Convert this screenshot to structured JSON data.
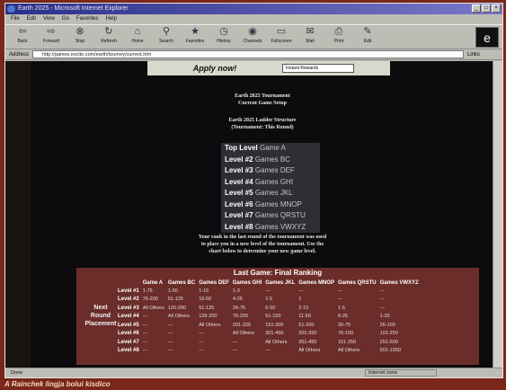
{
  "window": {
    "title": "Earth 2025 - Microsoft Internet Explorer"
  },
  "menu": [
    "File",
    "Edit",
    "View",
    "Go",
    "Favorites",
    "Help"
  ],
  "toolbar": [
    {
      "label": "Back",
      "icon": "back-arrow-icon"
    },
    {
      "label": "Forward",
      "icon": "forward-arrow-icon"
    },
    {
      "label": "Stop",
      "icon": "stop-icon"
    },
    {
      "label": "Refresh",
      "icon": "refresh-icon"
    },
    {
      "label": "Home",
      "icon": "home-icon"
    },
    {
      "label": "Search",
      "icon": "search-icon"
    },
    {
      "label": "Favorites",
      "icon": "favorites-icon"
    },
    {
      "label": "History",
      "icon": "history-icon"
    },
    {
      "label": "Channels",
      "icon": "channels-icon"
    },
    {
      "label": "Fullscreen",
      "icon": "fullscreen-icon"
    },
    {
      "label": "Mail",
      "icon": "mail-icon"
    },
    {
      "label": "Print",
      "icon": "print-icon"
    },
    {
      "label": "Edit",
      "icon": "edit-icon"
    }
  ],
  "address": {
    "label": "Address",
    "url": "http://games.excite.com/earth/tourney/current.htm",
    "links": "Links"
  },
  "banner": {
    "apply": "Apply now!",
    "select": "Instant Rewards"
  },
  "page": {
    "title1": "Earth 2025 Tournament",
    "title2": "Current Game Setup",
    "title3": "Earth 2025 Ladder Structure",
    "title4": "(Tournament: This Round)",
    "levels": [
      {
        "level": "Top Level",
        "games": "Game A"
      },
      {
        "level": "Level #2",
        "games": "Games BC"
      },
      {
        "level": "Level #3",
        "games": "Games DEF"
      },
      {
        "level": "Level #4",
        "games": "Games GHI"
      },
      {
        "level": "Level #5",
        "games": "Games JKL"
      },
      {
        "level": "Level #6",
        "games": "Games MNOP"
      },
      {
        "level": "Level #7",
        "games": "Games QRSTU"
      },
      {
        "level": "Level #8",
        "games": "Games VWXYZ"
      }
    ],
    "desc": [
      "Your rank in the last round of the tournament was used",
      "to place you in a new level of the tournament. Use the",
      "chart below to determine your new game level."
    ],
    "ranking": {
      "title": "Last Game: Final Ranking",
      "side_label": [
        "Next",
        "Round",
        "Placement"
      ],
      "columns": [
        "Game A",
        "Games BC",
        "Games DEF",
        "Games GHI",
        "Games JKL",
        "Games MNOP",
        "Games QRSTU",
        "Games VWXYZ"
      ],
      "rows": [
        {
          "label": "Level #1",
          "cells": [
            "1-75",
            "1-50",
            "1-15",
            "1-3",
            "---",
            "---",
            "---",
            "---"
          ]
        },
        {
          "label": "Level #2",
          "cells": [
            "76-200",
            "51-125",
            "16-50",
            "4-25",
            "1-5",
            "1",
            "---",
            "---"
          ]
        },
        {
          "label": "Level #3",
          "cells": [
            "All Others",
            "126-200",
            "51-125",
            "26-75",
            "6-50",
            "2-10",
            "1-5",
            "---"
          ]
        },
        {
          "label": "Level #4",
          "cells": [
            "---",
            "All Others",
            "126-200",
            "76-200",
            "51-150",
            "11-50",
            "6-25",
            "1-25"
          ]
        },
        {
          "label": "Level #5",
          "cells": [
            "---",
            "---",
            "All Others",
            "201-325",
            "151-300",
            "51-200",
            "26-75",
            "26-100"
          ]
        },
        {
          "label": "Level #6",
          "cells": [
            "---",
            "---",
            "---",
            "All Others",
            "301-450",
            "201-350",
            "76-150",
            "101-250"
          ]
        },
        {
          "label": "Level #7",
          "cells": [
            "---",
            "---",
            "---",
            "---",
            "All Others",
            "351-450",
            "151-250",
            "251-500"
          ]
        },
        {
          "label": "Level #8",
          "cells": [
            "---",
            "---",
            "---",
            "---",
            "---",
            "All Others",
            "All Others",
            "501-1000"
          ]
        }
      ]
    }
  },
  "status": {
    "text": "Done",
    "zone": "Internet zone"
  },
  "caption": "A Rainchek lingja bolui kisdico"
}
